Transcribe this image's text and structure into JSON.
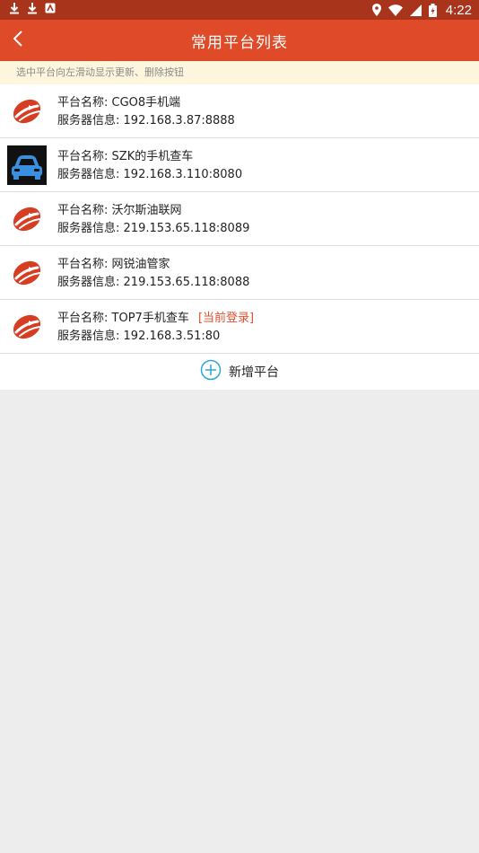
{
  "status_bar": {
    "time": "4:22",
    "left_icons": [
      "download-icon",
      "download-icon",
      "app-notification-icon"
    ],
    "right_icons": [
      "location-icon",
      "wifi-icon",
      "signal-icon",
      "battery-icon"
    ]
  },
  "app_bar": {
    "title": "常用平台列表",
    "back_icon": "chevron-left-icon",
    "background": "#df4a28"
  },
  "hint": "选中平台向左滑动显示更新、删除按钮",
  "platforms": [
    {
      "name_label": "平台名称:",
      "name": "CGO8手机端",
      "server_label": "服务器信息:",
      "server": "192.168.3.87:8888",
      "icon": "logo-icon",
      "tag": ""
    },
    {
      "name_label": "平台名称:",
      "name": "SZK的手机查车",
      "server_label": "服务器信息:",
      "server": "192.168.3.110:8080",
      "icon": "car-icon",
      "tag": ""
    },
    {
      "name_label": "平台名称:",
      "name": "沃尔斯油联网",
      "server_label": "服务器信息:",
      "server": "219.153.65.118:8089",
      "icon": "logo-icon",
      "tag": ""
    },
    {
      "name_label": "平台名称:",
      "name": "网锐油管家",
      "server_label": "服务器信息:",
      "server": "219.153.65.118:8088",
      "icon": "logo-icon",
      "tag": ""
    },
    {
      "name_label": "平台名称:",
      "name": "TOP7手机查车",
      "server_label": "服务器信息:",
      "server": "192.168.3.51:80",
      "icon": "logo-icon",
      "tag": "[当前登录]"
    }
  ],
  "add_button": {
    "label": "新增平台",
    "icon": "plus-circle-icon",
    "accent": "#29a7d6"
  }
}
